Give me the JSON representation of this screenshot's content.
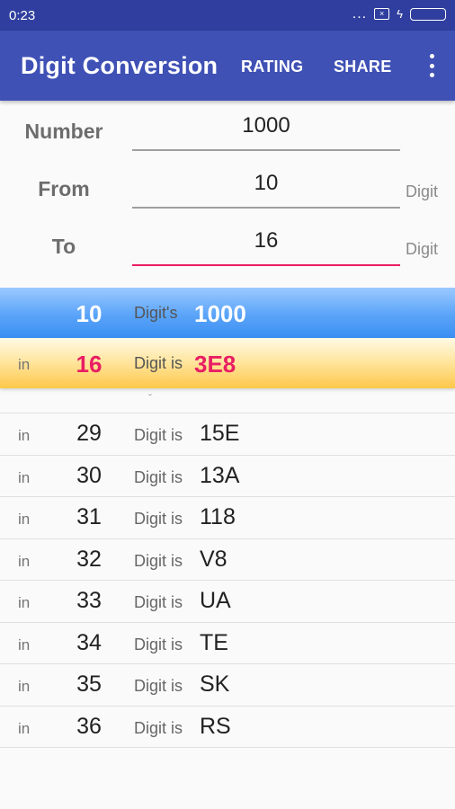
{
  "status_bar": {
    "time": "0:23",
    "signal": "...",
    "sim": "×",
    "charging": "ϟ"
  },
  "app_bar": {
    "title": "Digit Conversion",
    "actions": [
      "RATING",
      "SHARE"
    ],
    "overflow_icon": "more-vert"
  },
  "form": {
    "number": {
      "label": "Number",
      "value": "1000"
    },
    "from": {
      "label": "From",
      "value": "10",
      "unit": "Digit"
    },
    "to": {
      "label": "To",
      "value": "16",
      "unit": "Digit"
    }
  },
  "highlight": {
    "source": {
      "base": "10",
      "mid": "Digit's",
      "result": "1000"
    },
    "target": {
      "prefix": "in",
      "base": "16",
      "mid": "Digit is",
      "result": "3E8"
    }
  },
  "list": {
    "top_fragment": "ˇ",
    "rows": [
      {
        "prefix": "in",
        "base": "29",
        "mid": "Digit is",
        "result": "15E"
      },
      {
        "prefix": "in",
        "base": "30",
        "mid": "Digit is",
        "result": "13A"
      },
      {
        "prefix": "in",
        "base": "31",
        "mid": "Digit is",
        "result": "118"
      },
      {
        "prefix": "in",
        "base": "32",
        "mid": "Digit is",
        "result": "V8"
      },
      {
        "prefix": "in",
        "base": "33",
        "mid": "Digit is",
        "result": "UA"
      },
      {
        "prefix": "in",
        "base": "34",
        "mid": "Digit is",
        "result": "TE"
      },
      {
        "prefix": "in",
        "base": "35",
        "mid": "Digit is",
        "result": "SK"
      },
      {
        "prefix": "in",
        "base": "36",
        "mid": "Digit is",
        "result": "RS"
      }
    ]
  },
  "colors": {
    "primary": "#3f51b5",
    "primary_dark": "#303f9f",
    "accent": "#e91e63",
    "battery": "#8bc34a"
  }
}
